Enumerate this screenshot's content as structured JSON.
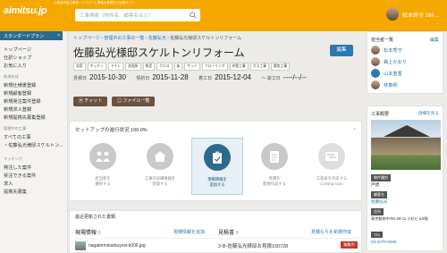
{
  "header": {
    "logo": "aimitsu.jp",
    "top_note": "工務店の施工事例・リフォーム業者の見積もり比較サイト",
    "search_placeholder": "工事検索（物件名、顧客名など）",
    "username": "松本秀守 166 ...",
    "brand_color": "#f5a800"
  },
  "sidebar": {
    "plan_label": "スタンダードプラン",
    "plan_close": "×",
    "items_group1": [
      "トップページ",
      "仕訳ショップ",
      "お気に入り"
    ],
    "head_new": "新規作成",
    "items_new": [
      "新規仕様書登録",
      "新規顧客登録",
      "新規発注案件登録",
      "新規求人登録",
      "新規提携先募集登録"
    ],
    "head_works": "管理中の工事",
    "items_works": [
      "すべての工事",
      "・佐藤弘光様邸スケルトン..."
    ],
    "head_match": "マッチング",
    "items_match": [
      "発注した案件",
      "受注できる案件",
      "求人",
      "提携先募集"
    ]
  },
  "main": {
    "breadcrumb": [
      "トップページ",
      "管理中の工事の一覧",
      "佐藤弘光",
      "佐藤弘光様邸スケルトンリフォーム"
    ],
    "title": "佐藤弘光様邸スケルトンリフォーム",
    "edit_label": "編集",
    "tags": [
      "浴室",
      "キッチン",
      "トイレ",
      "洗面所",
      "和室",
      "クロス",
      "床",
      "サッシ",
      "フローリング",
      "外壁工事",
      "ガス工事",
      "電気工事"
    ],
    "dates": {
      "estimate_label": "見積日",
      "estimate": "2015-10-30",
      "contract_label": "契約日",
      "contract": "2015-11-28",
      "start_label": "着工日",
      "start": "2015-12-04",
      "end_label": "〜 竣工日",
      "end": "----/--/--"
    },
    "chat_label": "チャット",
    "files_label": "ファイル一覧",
    "setup_title": "セットアップの進行状況 100.0%",
    "steps": [
      {
        "label": "担当者を\n選択する"
      },
      {
        "label": "工事の詳細情報を\n登録する"
      },
      {
        "label": "現場情報を\n追加する"
      },
      {
        "label": "見積を\n新規作成する"
      },
      {
        "label": "工程表を作成する\nComing soon"
      }
    ],
    "recent_title": "最近更新された書類",
    "site_label": "現場情報",
    "site_count": "0",
    "site_add": "現場情報を追加",
    "site_file": "nagatomokatsuyosi-k006.jpg",
    "estimate_label": "見積書",
    "estimate_count": "0",
    "estimate_add": "見積もりを新規作成",
    "estimate_doc": "2-B-佐藤弘光様邸お見積150728",
    "status_badge": "編集中"
  },
  "right": {
    "members_title": "担当者一覧",
    "members_edit": "編集",
    "members": [
      "松本秀守",
      "嶋上かおり",
      "山本重香",
      "林泰邦"
    ],
    "work_title": "工事概要",
    "work_edit": "詳細を見る",
    "type_badge": "物件種別",
    "type_value": "戸建",
    "customer_badge": "顧客名",
    "customer_value": "佐藤弘光",
    "address_badge": "住所",
    "address_value": "東京都府中市1-28-11 小杉ビル8階",
    "tel_badge": "TEL",
    "tel_value": "03-3278-5566"
  }
}
